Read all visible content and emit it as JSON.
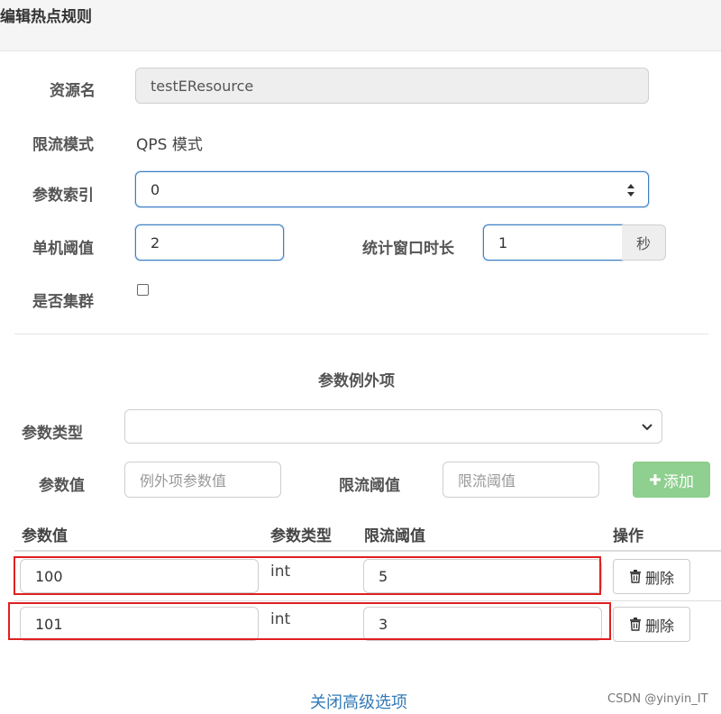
{
  "header": {
    "title": "编辑热点规则"
  },
  "form": {
    "resource_label": "资源名",
    "resource_value": "testEResource",
    "mode_label": "限流模式",
    "mode_value": "QPS 模式",
    "param_index_label": "参数索引",
    "param_index_value": "0",
    "threshold_label": "单机阈值",
    "threshold_value": "2",
    "window_label": "统计窗口时长",
    "window_value": "1",
    "window_unit": "秒",
    "cluster_label": "是否集群",
    "cluster_checked": false
  },
  "exceptions": {
    "section_title": "参数例外项",
    "param_type_label": "参数类型",
    "param_type_value": "",
    "param_value_label": "参数值",
    "param_value_placeholder": "例外项参数值",
    "limit_label": "限流阈值",
    "limit_placeholder": "限流阈值",
    "add_button": "添加"
  },
  "table": {
    "headers": [
      "参数值",
      "参数类型",
      "限流阈值",
      "操作"
    ],
    "rows": [
      {
        "value": "100",
        "type": "int",
        "limit": "5",
        "action": "删除"
      },
      {
        "value": "101",
        "type": "int",
        "limit": "3",
        "action": "删除"
      }
    ]
  },
  "footer": {
    "toggle_link": "关闭高级选项",
    "watermark": "CSDN @yinyin_IT"
  },
  "colors": {
    "accent_blue": "#3b7fc4",
    "add_green": "#8fcf8f",
    "highlight_red": "#e02020",
    "link_blue": "#337ab7"
  }
}
